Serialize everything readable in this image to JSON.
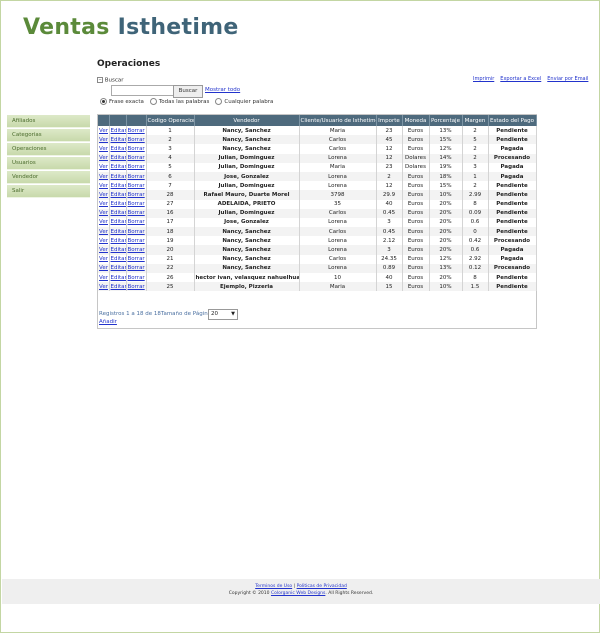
{
  "logo": {
    "part1": "Ventas",
    "part2": "Isthetime"
  },
  "page_title": "Operaciones",
  "sidebar": {
    "items": [
      {
        "label": "Afiliados"
      },
      {
        "label": "Categorias"
      },
      {
        "label": "Operaciones"
      },
      {
        "label": "Usuarios"
      },
      {
        "label": "Vendedor"
      },
      {
        "label": "Salir"
      }
    ]
  },
  "search": {
    "toggle_label": "Buscar",
    "input_value": "",
    "button_label": "Buscar",
    "show_all": "Mostrar todo",
    "radio_exact": "Frase exacta",
    "radio_all": "Todas las palabras",
    "radio_any": "Cualquier palabra"
  },
  "top_links": {
    "print": "Imprimir",
    "excel": "Exportar a Excel",
    "email": "Enviar por Email"
  },
  "table": {
    "headers": [
      "",
      "",
      "",
      "Codigo Operacion",
      "Vendedor",
      "Cliente/Usuario de Isthetime",
      "Importe",
      "Moneda",
      "Porcentaje",
      "Margen",
      "Estado del Pago"
    ],
    "action_labels": {
      "view": "Ver",
      "edit": "Editar",
      "delete": "Borrar"
    },
    "rows": [
      {
        "code": "1",
        "vendor": "Nancy, Sanchez",
        "client": "Maria",
        "amount": "23",
        "currency": "Euros",
        "percent": "13%",
        "margin": "2",
        "status": "Pendiente"
      },
      {
        "code": "2",
        "vendor": "Nancy, Sanchez",
        "client": "Carlos",
        "amount": "45",
        "currency": "Euros",
        "percent": "15%",
        "margin": "5",
        "status": "Pendiente"
      },
      {
        "code": "3",
        "vendor": "Nancy, Sanchez",
        "client": "Carlos",
        "amount": "12",
        "currency": "Euros",
        "percent": "12%",
        "margin": "2",
        "status": "Pagada"
      },
      {
        "code": "4",
        "vendor": "Julian, Dominguez",
        "client": "Lorena",
        "amount": "12",
        "currency": "Dolares",
        "percent": "14%",
        "margin": "2",
        "status": "Procesando"
      },
      {
        "code": "5",
        "vendor": "Julian, Dominguez",
        "client": "Maria",
        "amount": "23",
        "currency": "Dolares",
        "percent": "19%",
        "margin": "3",
        "status": "Pagada"
      },
      {
        "code": "6",
        "vendor": "Jose, Gonzalez",
        "client": "Lorena",
        "amount": "2",
        "currency": "Euros",
        "percent": "18%",
        "margin": "1",
        "status": "Pagada"
      },
      {
        "code": "7",
        "vendor": "Julian, Dominguez",
        "client": "Lorena",
        "amount": "12",
        "currency": "Euros",
        "percent": "15%",
        "margin": "2",
        "status": "Pendiente"
      },
      {
        "code": "28",
        "vendor": "Rafael Mauro, Duarte Morel",
        "client": "3798",
        "amount": "29.9",
        "currency": "Euros",
        "percent": "10%",
        "margin": "2.99",
        "status": "Pendiente"
      },
      {
        "code": "27",
        "vendor": "ADELAIDA, PRIETO",
        "client": "35",
        "amount": "40",
        "currency": "Euros",
        "percent": "20%",
        "margin": "8",
        "status": "Pendiente"
      },
      {
        "code": "16",
        "vendor": "Julian, Dominguez",
        "client": "Carlos",
        "amount": "0.45",
        "currency": "Euros",
        "percent": "20%",
        "margin": "0.09",
        "status": "Pendiente"
      },
      {
        "code": "17",
        "vendor": "Jose, Gonzalez",
        "client": "Lorena",
        "amount": "3",
        "currency": "Euros",
        "percent": "20%",
        "margin": "0.6",
        "status": "Pendiente"
      },
      {
        "code": "18",
        "vendor": "Nancy, Sanchez",
        "client": "Carlos",
        "amount": "0.45",
        "currency": "Euros",
        "percent": "20%",
        "margin": "0",
        "status": "Pendiente"
      },
      {
        "code": "19",
        "vendor": "Nancy, Sanchez",
        "client": "Lorena",
        "amount": "2.12",
        "currency": "Euros",
        "percent": "20%",
        "margin": "0.42",
        "status": "Procesando"
      },
      {
        "code": "20",
        "vendor": "Nancy, Sanchez",
        "client": "Lorena",
        "amount": "3",
        "currency": "Euros",
        "percent": "20%",
        "margin": "0.6",
        "status": "Pagada"
      },
      {
        "code": "21",
        "vendor": "Nancy, Sanchez",
        "client": "Carlos",
        "amount": "24.35",
        "currency": "Euros",
        "percent": "12%",
        "margin": "2.92",
        "status": "Pagada"
      },
      {
        "code": "22",
        "vendor": "Nancy, Sanchez",
        "client": "Lorena",
        "amount": "0.89",
        "currency": "Euros",
        "percent": "13%",
        "margin": "0.12",
        "status": "Procesando"
      },
      {
        "code": "26",
        "vendor": "hector ivan, velasquez nahuelhualque",
        "client": "10",
        "amount": "40",
        "currency": "Euros",
        "percent": "20%",
        "margin": "8",
        "status": "Pendiente"
      },
      {
        "code": "25",
        "vendor": "Ejemplo, Pizzeria",
        "client": "Maria",
        "amount": "15",
        "currency": "Euros",
        "percent": "10%",
        "margin": "1.5",
        "status": "Pendiente"
      }
    ]
  },
  "pagination": {
    "records": "Registros 1 a 18 de 18",
    "page_size_label": "Tamaño de Página",
    "page_size": "20"
  },
  "add_label": "Añadir",
  "footer": {
    "terms": "Terminos de Uso",
    "separator": "|",
    "privacy": "Politicas de Privacidad",
    "copyright_prefix": "Copyright © 2010",
    "company": "Colorganic Web Designs",
    "rights": ". All Rights Reserved."
  },
  "colors": {
    "header_bg": "#4e6a7d",
    "sidebar_bg": "#c8d9ab",
    "logo_green": "#5b8a3a",
    "logo_blue": "#3f6478"
  }
}
